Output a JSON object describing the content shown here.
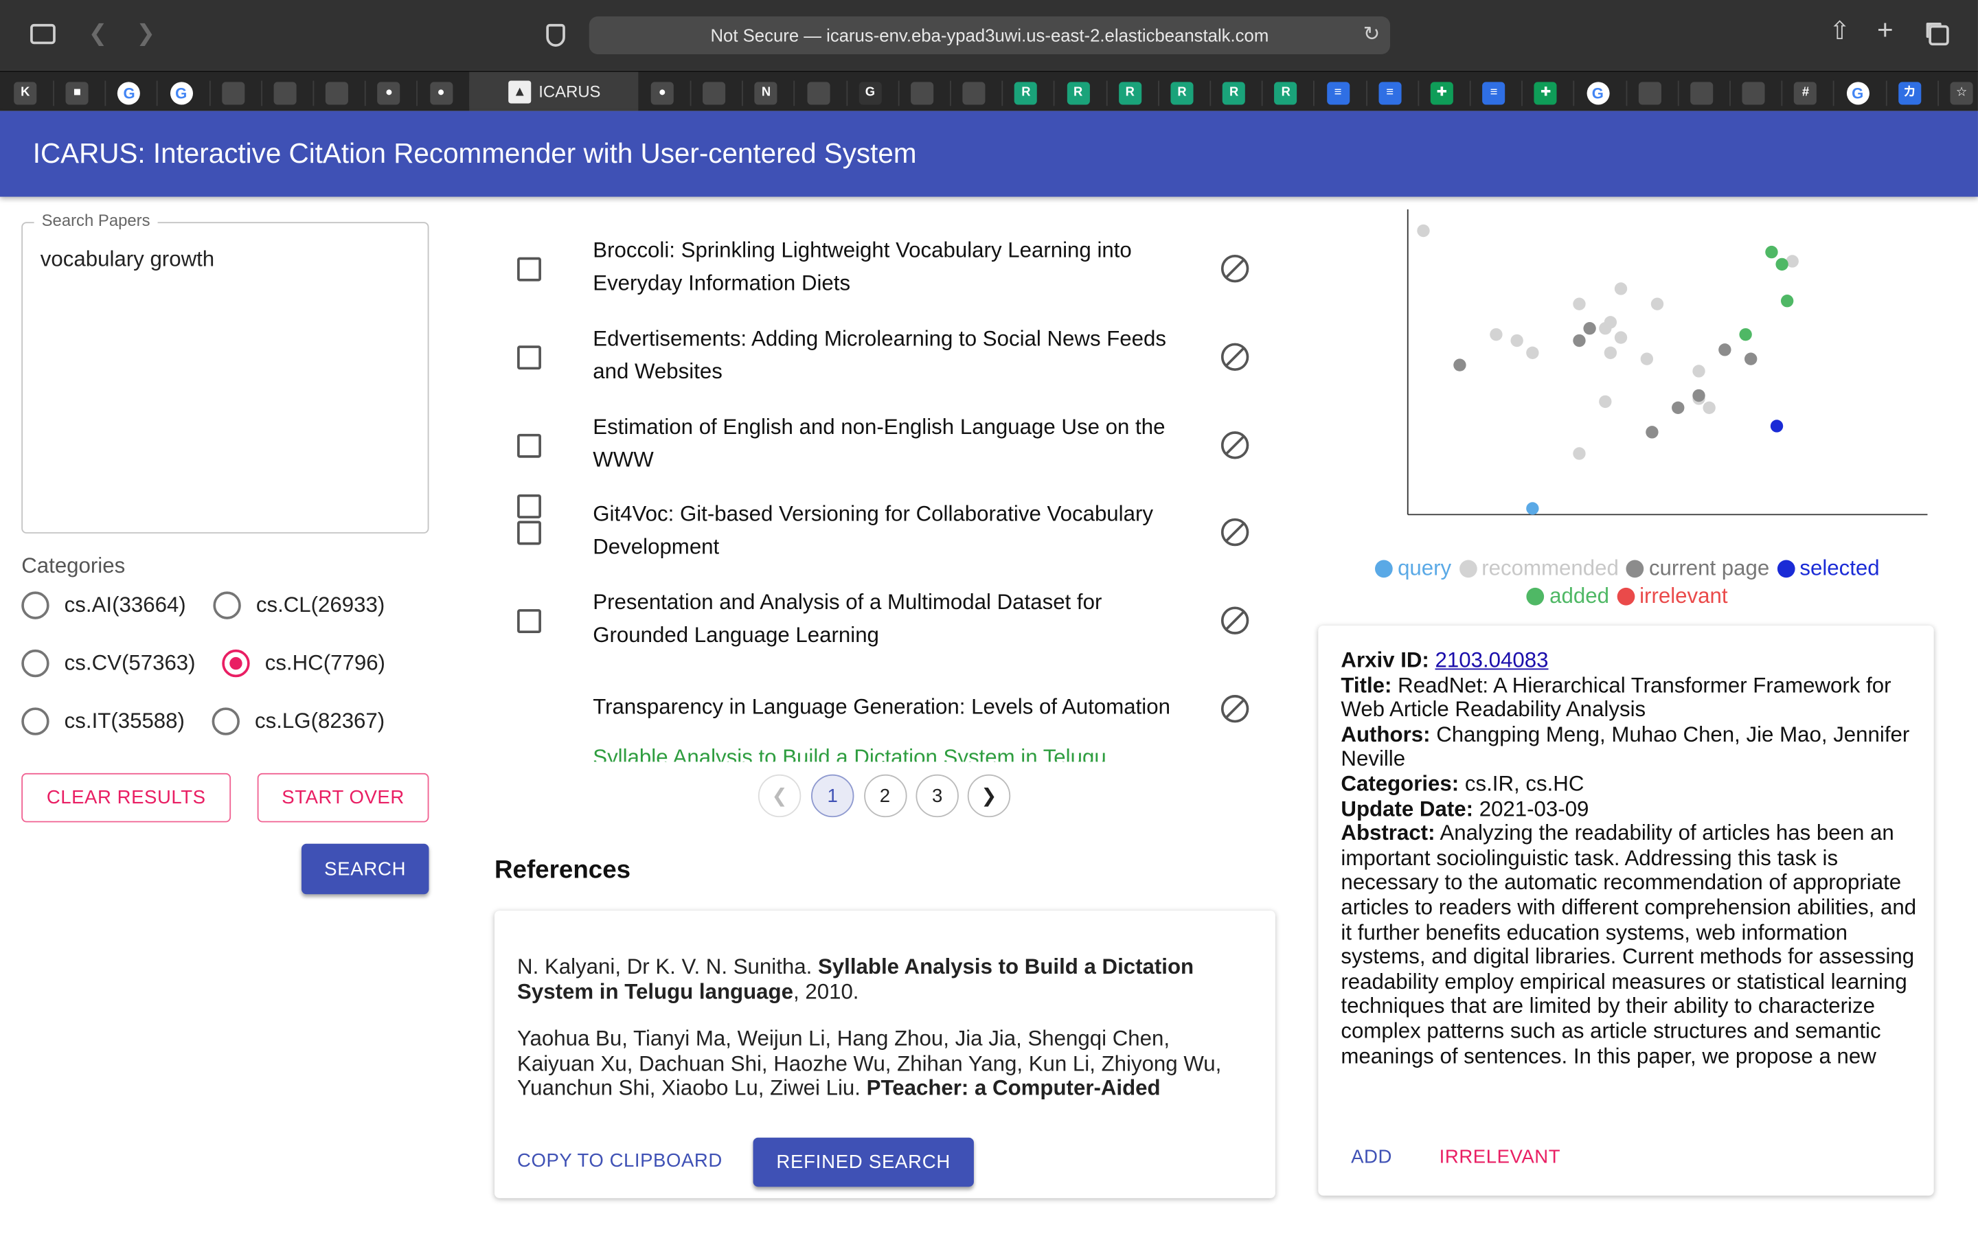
{
  "browser": {
    "url_text": "Not Secure — icarus-env.eba-ypad3uwi.us-east-2.elasticbeanstalk.com",
    "active_tab_label": "ICARUS",
    "bookmarks": [
      "kaist",
      "zoom",
      "google",
      "google",
      "hdys",
      "inbox",
      "photos",
      "apple",
      "globe",
      "icarus",
      "github",
      "cloud",
      "notion",
      "figma",
      "g",
      "chat",
      "beer",
      "rg",
      "rg",
      "rg",
      "rg",
      "rg",
      "rg",
      "docs",
      "outline",
      "sheets",
      "docs",
      "sheets",
      "google",
      "ruler",
      "dots",
      "dots",
      "slack",
      "google",
      "ga",
      "star"
    ]
  },
  "app": {
    "title": "ICARUS: Interactive CitAtion Recommender with User-centered System"
  },
  "search": {
    "label": "Search Papers",
    "value": "vocabulary growth",
    "categories_label": "Categories",
    "categories": [
      {
        "label": "cs.AI(33664)",
        "selected": false
      },
      {
        "label": "cs.CL(26933)",
        "selected": false
      },
      {
        "label": "cs.CV(57363)",
        "selected": false
      },
      {
        "label": "cs.HC(7796)",
        "selected": true
      },
      {
        "label": "cs.IT(35588)",
        "selected": false
      },
      {
        "label": "cs.LG(82367)",
        "selected": false
      }
    ],
    "clear_label": "CLEAR RESULTS",
    "start_over_label": "START OVER",
    "search_label": "SEARCH"
  },
  "results": {
    "items": [
      {
        "title": "Broccoli: Sprinkling Lightweight Vocabulary Learning into Everyday Information Diets"
      },
      {
        "title": "Edvertisements: Adding Microlearning to Social News Feeds and Websites"
      },
      {
        "title": "Estimation of English and non-English Language Use on the WWW"
      },
      {
        "title": "Git4Voc: Git-based Versioning for Collaborative Vocabulary Development"
      },
      {
        "title": "Presentation and Analysis of a Multimodal Dataset for Grounded Language Learning"
      },
      {
        "title": "Transparency in Language Generation: Levels of Automation"
      }
    ],
    "partial_item": "Syllable Analysis to Build a Dictation System in Telugu",
    "pages": [
      "1",
      "2",
      "3"
    ],
    "current_page": "1"
  },
  "references": {
    "heading": "References",
    "items": [
      {
        "authors": "N. Kalyani, Dr K. V. N. Sunitha. ",
        "title": "Syllable Analysis to Build a Dictation System in Telugu language",
        "year": ", 2010."
      },
      {
        "authors": "Yaohua Bu, Tianyi Ma, Weijun Li, Hang Zhou, Jia Jia, Shengqi Chen, Kaiyuan Xu, Dachuan Shi, Haozhe Wu, Zhihan Yang, Kun Li, Zhiyong Wu, Yuanchun Shi, Xiaobo Lu, Ziwei Liu. ",
        "title": "PTeacher: a Computer-Aided Personalized Pronunciation Training System",
        "year": ""
      }
    ],
    "copy_label": "COPY TO CLIPBOARD",
    "refined_label": "REFINED SEARCH"
  },
  "scatter": {
    "colors": {
      "query": "#5aa9e6",
      "recommended": "#d3d3d3",
      "current": "#8c8c8c",
      "selected": "#1a2bd6",
      "added": "#4fb865"
    },
    "points": [
      {
        "x": 0.03,
        "y": 0.93,
        "k": "recommended"
      },
      {
        "x": 0.17,
        "y": 0.59,
        "k": "recommended"
      },
      {
        "x": 0.21,
        "y": 0.57,
        "k": "recommended"
      },
      {
        "x": 0.24,
        "y": 0.53,
        "k": "recommended"
      },
      {
        "x": 0.33,
        "y": 0.69,
        "k": "recommended"
      },
      {
        "x": 0.33,
        "y": 0.2,
        "k": "recommended"
      },
      {
        "x": 0.38,
        "y": 0.61,
        "k": "recommended"
      },
      {
        "x": 0.38,
        "y": 0.37,
        "k": "recommended"
      },
      {
        "x": 0.39,
        "y": 0.63,
        "k": "recommended"
      },
      {
        "x": 0.39,
        "y": 0.53,
        "k": "recommended"
      },
      {
        "x": 0.41,
        "y": 0.58,
        "k": "recommended"
      },
      {
        "x": 0.41,
        "y": 0.74,
        "k": "recommended"
      },
      {
        "x": 0.46,
        "y": 0.51,
        "k": "recommended"
      },
      {
        "x": 0.48,
        "y": 0.69,
        "k": "recommended"
      },
      {
        "x": 0.56,
        "y": 0.47,
        "k": "recommended"
      },
      {
        "x": 0.58,
        "y": 0.35,
        "k": "recommended"
      },
      {
        "x": 0.56,
        "y": 0.38,
        "k": "recommended"
      },
      {
        "x": 0.74,
        "y": 0.83,
        "k": "recommended"
      },
      {
        "x": 0.1,
        "y": 0.49,
        "k": "current"
      },
      {
        "x": 0.33,
        "y": 0.57,
        "k": "current"
      },
      {
        "x": 0.35,
        "y": 0.61,
        "k": "current"
      },
      {
        "x": 0.47,
        "y": 0.27,
        "k": "current"
      },
      {
        "x": 0.52,
        "y": 0.35,
        "k": "current"
      },
      {
        "x": 0.56,
        "y": 0.39,
        "k": "current"
      },
      {
        "x": 0.61,
        "y": 0.54,
        "k": "current"
      },
      {
        "x": 0.66,
        "y": 0.51,
        "k": "current"
      },
      {
        "x": 0.7,
        "y": 0.86,
        "k": "added"
      },
      {
        "x": 0.72,
        "y": 0.82,
        "k": "added"
      },
      {
        "x": 0.73,
        "y": 0.7,
        "k": "added"
      },
      {
        "x": 0.65,
        "y": 0.59,
        "k": "added"
      },
      {
        "x": 0.71,
        "y": 0.29,
        "k": "selected"
      },
      {
        "x": 0.24,
        "y": 0.02,
        "k": "query"
      }
    ]
  },
  "legend": {
    "items": [
      {
        "label": "query",
        "color": "#5aa9e6",
        "text_color": "#5aa9e6"
      },
      {
        "label": "recommended",
        "color": "#d3d3d3",
        "text_color": "#c8c8c8"
      },
      {
        "label": "current page",
        "color": "#8c8c8c",
        "text_color": "#777777"
      },
      {
        "label": "selected",
        "color": "#1a2bd6",
        "text_color": "#1a2bd6"
      },
      {
        "label": "added",
        "color": "#4fb865",
        "text_color": "#4fb865"
      },
      {
        "label": "irrelevant",
        "color": "#ea4a4a",
        "text_color": "#ea4a4a"
      }
    ]
  },
  "detail": {
    "arxiv_label": "Arxiv ID:",
    "arxiv_id": "2103.04083",
    "title_label": "Title:",
    "title": "ReadNet: A Hierarchical Transformer Framework for Web Article Readability Analysis",
    "authors_label": "Authors:",
    "authors": "Changping Meng, Muhao Chen, Jie Mao, Jennifer Neville",
    "categories_label": "Categories:",
    "categories": "cs.IR, cs.HC",
    "date_label": "Update Date:",
    "date": "2021-03-09",
    "abstract_label": "Abstract:",
    "abstract": "Analyzing the readability of articles has been an important sociolinguistic task. Addressing this task is necessary to the automatic recommendation of appropriate articles to readers with different comprehension abilities, and it further benefits education systems, web information systems, and digital libraries. Current methods for assessing readability employ empirical measures or statistical learning techniques that are limited by their ability to characterize complex patterns such as article structures and semantic meanings of sentences. In this paper, we propose a new",
    "add_label": "ADD",
    "irrelevant_label": "IRRELEVANT"
  }
}
